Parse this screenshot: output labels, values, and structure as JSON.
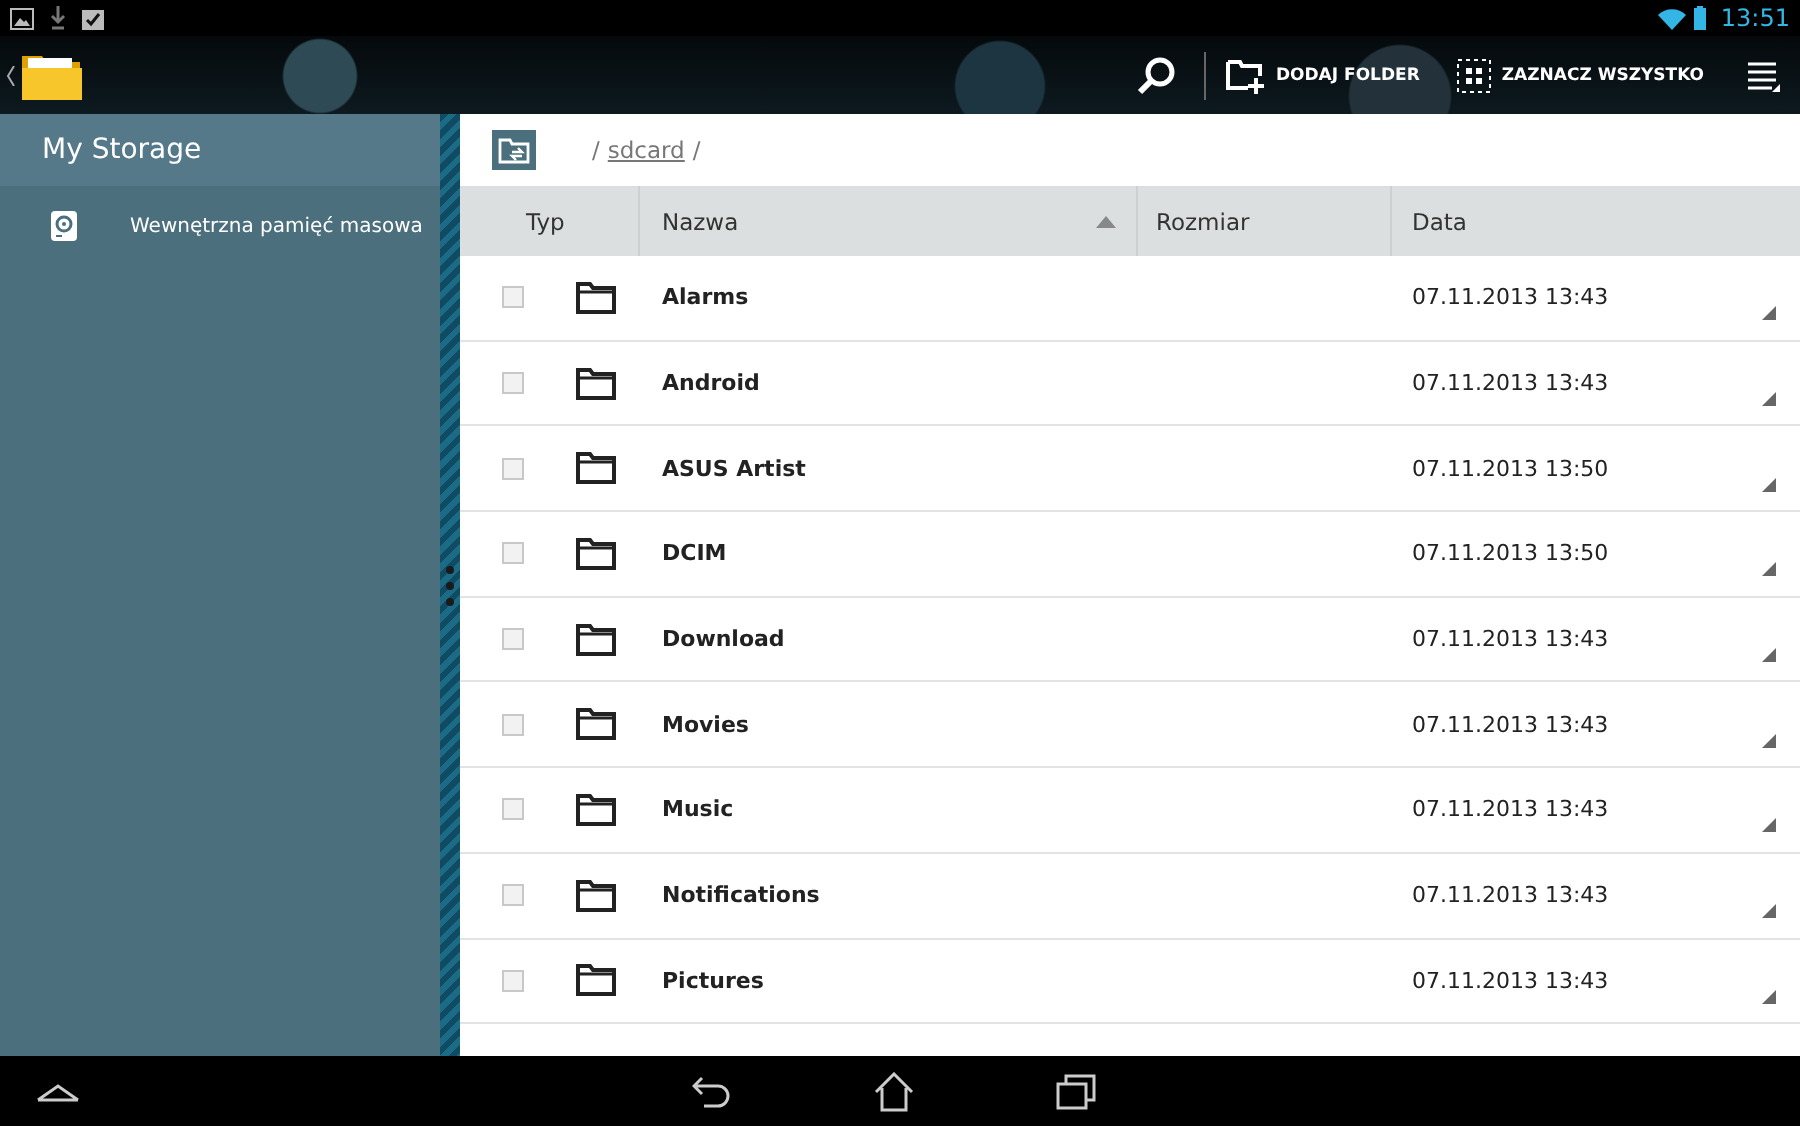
{
  "status_bar": {
    "time": "13:51"
  },
  "action_bar": {
    "actions": [
      {
        "kind": "add-folder",
        "label": "DODAJ FOLDER"
      },
      {
        "kind": "select-all",
        "label": "ZAZNACZ WSZYSTKO"
      }
    ]
  },
  "sidebar": {
    "title": "My Storage",
    "items": [
      {
        "label": "Wewnętrzna pamięć masowa",
        "selected": false
      }
    ]
  },
  "breadcrumb": {
    "separator_1": "/",
    "folder": "sdcard",
    "separator_2": "/"
  },
  "table": {
    "columns": [
      {
        "label": "Typ",
        "sorted": false
      },
      {
        "label": "Nazwa",
        "sorted": true
      },
      {
        "label": "Rozmiar",
        "sorted": false
      },
      {
        "label": "Data",
        "sorted": false
      }
    ],
    "rows": [
      {
        "name": "Alarms",
        "date": "07.11.2013 13:43",
        "checked": false
      },
      {
        "name": "Android",
        "date": "07.11.2013 13:43",
        "checked": false
      },
      {
        "name": "ASUS Artist",
        "date": "07.11.2013 13:50",
        "checked": false
      },
      {
        "name": "DCIM",
        "date": "07.11.2013 13:50",
        "checked": false
      },
      {
        "name": "Download",
        "date": "07.11.2013 13:43",
        "checked": false
      },
      {
        "name": "Movies",
        "date": "07.11.2013 13:43",
        "checked": false
      },
      {
        "name": "Music",
        "date": "07.11.2013 13:43",
        "checked": false
      },
      {
        "name": "Notifications",
        "date": "07.11.2013 13:43",
        "checked": false
      },
      {
        "name": "Pictures",
        "date": "07.11.2013 13:43",
        "checked": false
      }
    ]
  }
}
